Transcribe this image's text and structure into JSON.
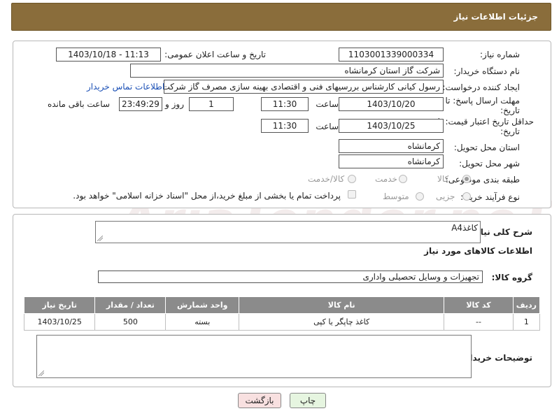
{
  "header": {
    "title": "جزئیات اطلاعات نیاز"
  },
  "form": {
    "need_number_label": "شماره نیاز:",
    "need_number": "1103001339000334",
    "announce_label": "تاریخ و ساعت اعلان عمومی:",
    "announce_value": "1403/10/18 - 11:13",
    "buyer_org_label": "نام دستگاه خریدار:",
    "buyer_org": "شرکت گاز استان کرمانشاه",
    "creator_label": "ایجاد کننده درخواست:",
    "creator": "رسول کیانی کارشناس بررسیهای فنی و اقتصادی بهینه سازی مصرف گاز شرکت",
    "contact_link": "اطلاعات تماس خریدار",
    "deadline_label_1": "مهلت ارسال پاسخ: تا",
    "deadline_label_2": "تاریخ:",
    "deadline_date": "1403/10/20",
    "time_label": "ساعت",
    "deadline_time": "11:30",
    "days_value": "1",
    "days_label": "روز و",
    "remaining_time": "23:49:29",
    "remaining_label": "ساعت باقی مانده",
    "price_label_1": "حداقل تاریخ اعتبار قیمت: تا",
    "price_label_2": "تاریخ:",
    "price_date": "1403/10/25",
    "price_time": "11:30",
    "province_label": "استان محل تحویل:",
    "province": "کرمانشاه",
    "city_label": "شهر محل تحویل:",
    "city": "کرمانشاه",
    "category_label": "طبقه بندی موضوعی:",
    "category_options": [
      "کالا",
      "خدمت",
      "کالا/خدمت"
    ],
    "category_selected": "کالا",
    "process_label": "نوع فرآیند خرید :",
    "process_options": [
      "جزیی",
      "متوسط"
    ],
    "payment_note": "پرداخت تمام یا بخشی از مبلغ خرید،از محل \"اسناد خزانه اسلامی\" خواهد بود."
  },
  "details": {
    "summary_label": "شرح کلی نیاز:",
    "summary_value": "کاغذA4",
    "goods_info_title": "اطلاعات کالاهای مورد نیاز",
    "goods_group_label": "گروه کالا:",
    "goods_group": "تجهیزات و وسایل تحصیلی واداری",
    "table": {
      "headers": [
        "ردیف",
        "کد کالا",
        "نام کالا",
        "واحد شمارش",
        "تعداد / مقدار",
        "تاریخ نیاز"
      ],
      "rows": [
        [
          "1",
          "--",
          "کاغذ چاپگر یا کپی",
          "بسته",
          "500",
          "1403/10/25"
        ]
      ]
    },
    "buyer_notes_label": "توضیحات خریدار:",
    "buyer_notes_value": ""
  },
  "buttons": {
    "print": "چاپ",
    "back": "بازگشت"
  },
  "watermark": "AriaTender.neT",
  "colors": {
    "header_bg": "#8a6d3b",
    "table_header_bg": "#8b8b8b",
    "link": "#1a4fb5",
    "back_button_bg": "#f8e0e0",
    "print_button_bg": "#e6f5e0"
  }
}
